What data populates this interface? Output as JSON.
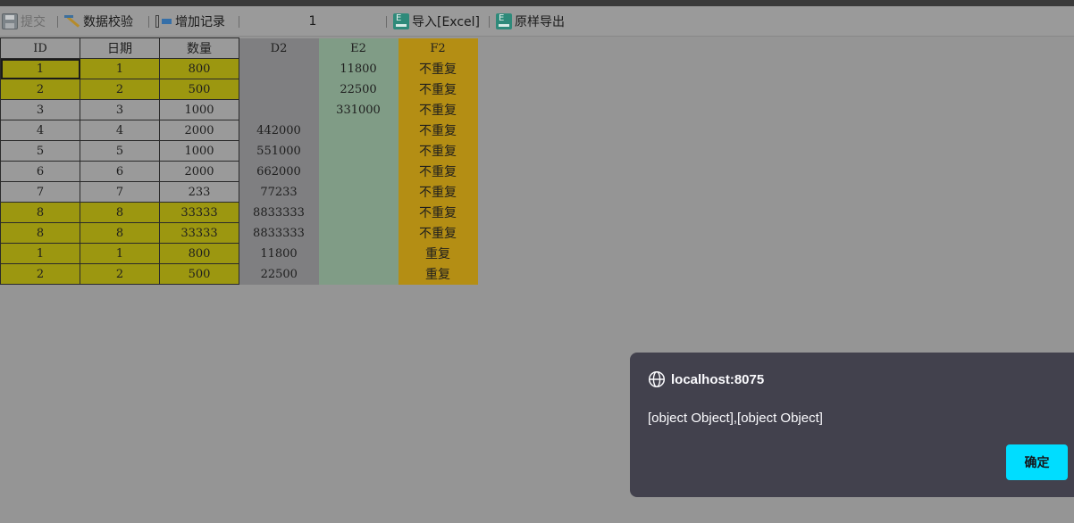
{
  "toolbar": {
    "submit_label": "提交",
    "validate_label": "数据校验",
    "add_record_label": "增加记录",
    "page_number": "1",
    "import_label": "导入[Excel]",
    "export_label": "原样导出"
  },
  "table": {
    "headers": [
      "ID",
      "日期",
      "数量",
      "D2",
      "E2",
      "F2"
    ],
    "rows": [
      {
        "id": "1",
        "date": "1",
        "qty": "800",
        "d2": "",
        "e2": "11800",
        "f2": "不重复"
      },
      {
        "id": "2",
        "date": "2",
        "qty": "500",
        "d2": "",
        "e2": "22500",
        "f2": "不重复"
      },
      {
        "id": "3",
        "date": "3",
        "qty": "1000",
        "d2": "",
        "e2": "331000",
        "f2": "不重复"
      },
      {
        "id": "4",
        "date": "4",
        "qty": "2000",
        "d2": "442000",
        "e2": "",
        "f2": "不重复"
      },
      {
        "id": "5",
        "date": "5",
        "qty": "1000",
        "d2": "551000",
        "e2": "",
        "f2": "不重复"
      },
      {
        "id": "6",
        "date": "6",
        "qty": "2000",
        "d2": "662000",
        "e2": "",
        "f2": "不重复"
      },
      {
        "id": "7",
        "date": "7",
        "qty": "233",
        "d2": "77233",
        "e2": "",
        "f2": "不重复"
      },
      {
        "id": "8",
        "date": "8",
        "qty": "33333",
        "d2": "8833333",
        "e2": "",
        "f2": "不重复"
      },
      {
        "id": "8",
        "date": "8",
        "qty": "33333",
        "d2": "8833333",
        "e2": "",
        "f2": "不重复"
      },
      {
        "id": "1",
        "date": "1",
        "qty": "800",
        "d2": "11800",
        "e2": "",
        "f2": "重复"
      },
      {
        "id": "2",
        "date": "2",
        "qty": "500",
        "d2": "22500",
        "e2": "",
        "f2": "重复"
      }
    ]
  },
  "dialog": {
    "origin": "localhost:8075",
    "message": "[object Object],[object Object]",
    "ok_label": "确定"
  },
  "colors": {
    "highlight_row": "#9c9710",
    "column_d": "#7f7f81",
    "column_e": "#809c86",
    "column_f": "#b48e14",
    "dialog_bg": "#42414d",
    "dialog_button": "#00ddff"
  }
}
